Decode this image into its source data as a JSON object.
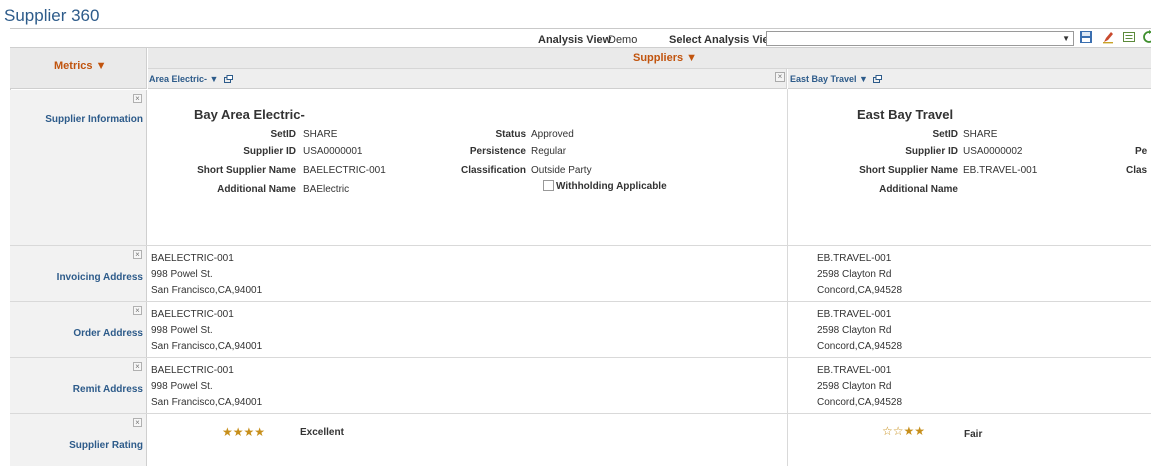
{
  "page": {
    "title": "Supplier 360"
  },
  "toolbar": {
    "analysis_view_label": "Analysis View",
    "analysis_view_value": "Demo",
    "select_analysis_view_label": "Select Analysis View",
    "select_analysis_view_value": "",
    "icons": [
      "save-icon",
      "edit-icon",
      "view-icon",
      "refresh-icon"
    ]
  },
  "grid": {
    "metrics_header": "Metrics ▼",
    "suppliers_header": "Suppliers ▼",
    "columns": [
      {
        "name": "Area Electric- ▼",
        "close": "×"
      },
      {
        "name": "East Bay Travel ▼",
        "close": "×"
      }
    ],
    "row_labels": {
      "supplier_information": "Supplier Information",
      "invoicing_address": "Invoicing Address",
      "order_address": "Order Address",
      "remit_address": "Remit Address",
      "supplier_rating": "Supplier Rating"
    },
    "close_glyph": "×"
  },
  "suppliers": [
    {
      "name": "Bay Area Electric-",
      "setid_label": "SetID",
      "setid": "SHARE",
      "supplier_id_label": "Supplier ID",
      "supplier_id": "USA0000001",
      "short_name_label": "Short Supplier Name",
      "short_name": "BAELECTRIC-001",
      "additional_name_label": "Additional Name",
      "additional_name": "BAElectric",
      "status_label": "Status",
      "status": "Approved",
      "persistence_label": "Persistence",
      "persistence": "Regular",
      "classification_label": "Classification",
      "classification": "Outside Party",
      "withholding_label": "Withholding Applicable",
      "invoicing_address": {
        "line1": "BAELECTRIC-001",
        "line2": "998 Powel St.",
        "line3": "San Francisco,CA,94001"
      },
      "order_address": {
        "line1": "BAELECTRIC-001",
        "line2": "998 Powel St.",
        "line3": "San Francisco,CA,94001"
      },
      "remit_address": {
        "line1": "BAELECTRIC-001",
        "line2": "998 Powel St.",
        "line3": "San Francisco,CA,94001"
      },
      "rating_stars": "★★★★",
      "rating_text": "Excellent"
    },
    {
      "name": "East Bay Travel",
      "setid_label": "SetID",
      "setid": "SHARE",
      "supplier_id_label": "Supplier ID",
      "supplier_id": "USA0000002",
      "short_name_label": "Short Supplier Name",
      "short_name": "EB.TRAVEL-001",
      "additional_name_label": "Additional Name",
      "additional_name": "",
      "persistence_label_partial": "Pe",
      "classification_label_partial": "Clas",
      "invoicing_address": {
        "line1": "EB.TRAVEL-001",
        "line2": "2598 Clayton Rd",
        "line3": "Concord,CA,94528"
      },
      "order_address": {
        "line1": "EB.TRAVEL-001",
        "line2": "2598 Clayton Rd",
        "line3": "Concord,CA,94528"
      },
      "remit_address": {
        "line1": "EB.TRAVEL-001",
        "line2": "2598 Clayton Rd",
        "line3": "Concord,CA,94528"
      },
      "rating_stars_empty": "☆☆",
      "rating_stars_full": "★★",
      "rating_text": "Fair"
    }
  ],
  "colors": {
    "accent": "#c1540e",
    "link": "#2d5b8a",
    "star": "#c78f1b"
  }
}
